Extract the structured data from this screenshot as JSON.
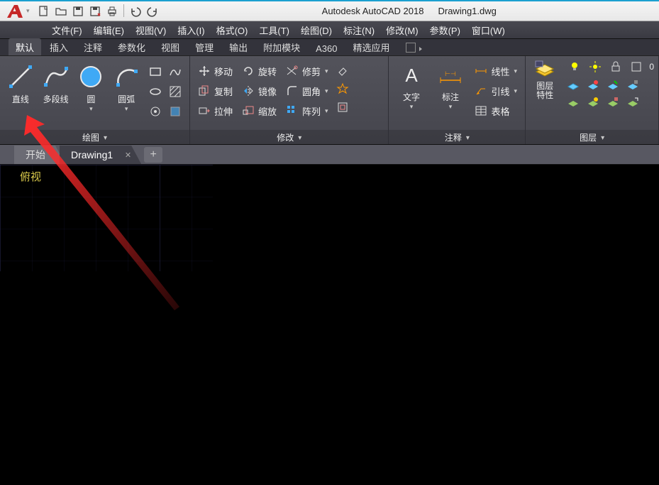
{
  "title": {
    "app": "Autodesk AutoCAD 2018",
    "file": "Drawing1.dwg"
  },
  "menubar": [
    "文件(F)",
    "编辑(E)",
    "视图(V)",
    "插入(I)",
    "格式(O)",
    "工具(T)",
    "绘图(D)",
    "标注(N)",
    "修改(M)",
    "参数(P)",
    "窗口(W)"
  ],
  "ribbon_tabs": [
    "默认",
    "插入",
    "注释",
    "参数化",
    "视图",
    "管理",
    "输出",
    "附加模块",
    "A360",
    "精选应用"
  ],
  "active_ribbon_tab": "默认",
  "panels": {
    "draw": {
      "footer": "绘图",
      "buttons": {
        "line": "直线",
        "polyline": "多段线",
        "circle": "圆",
        "arc": "圆弧"
      }
    },
    "modify": {
      "footer": "修改",
      "items": {
        "move": "移动",
        "copy": "复制",
        "stretch": "拉伸",
        "rotate": "旋转",
        "mirror": "镜像",
        "scale": "缩放",
        "trim": "修剪",
        "fillet": "圆角",
        "array": "阵列"
      }
    },
    "annotation": {
      "footer": "注释",
      "text": "文字",
      "dim": "标注",
      "items": {
        "linetype": "线性",
        "leader": "引线",
        "table": "表格"
      }
    },
    "layers": {
      "footer": "图层",
      "button": "图层\n特性",
      "zero": "0"
    }
  },
  "drawing_tabs": {
    "start": "开始",
    "active": "Drawing1"
  },
  "viewport": {
    "label": "俯视"
  }
}
